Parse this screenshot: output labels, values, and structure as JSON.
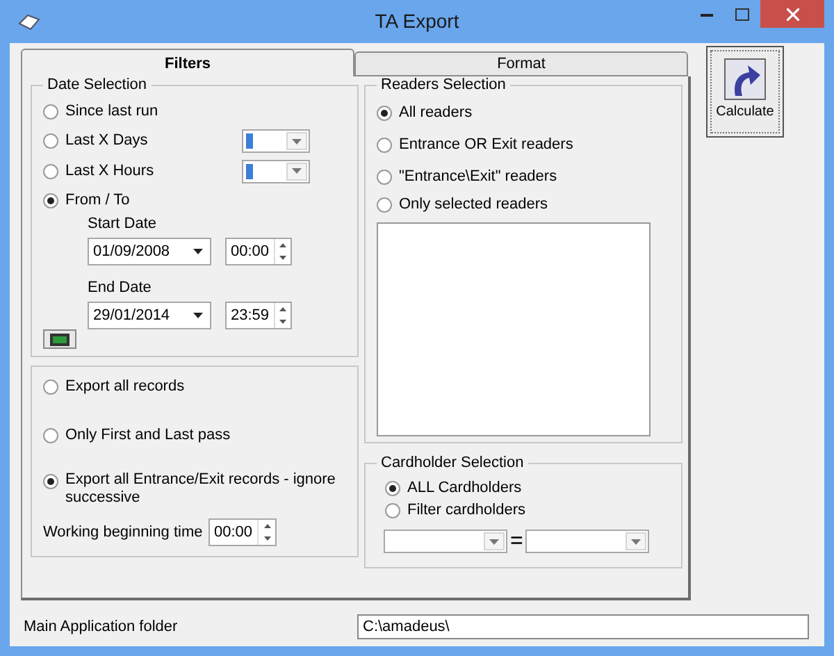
{
  "window": {
    "title": "TA Export"
  },
  "tabs": [
    {
      "label": "Filters",
      "selected": true
    },
    {
      "label": "Format",
      "selected": false
    }
  ],
  "date_selection": {
    "title": "Date Selection",
    "options": [
      {
        "label": "Since last run",
        "selected": false,
        "kind": "plain"
      },
      {
        "label": "Last X Days",
        "selected": false,
        "kind": "combo"
      },
      {
        "label": "Last X Hours",
        "selected": false,
        "kind": "combo"
      },
      {
        "label": "From / To",
        "selected": true,
        "kind": "plain"
      }
    ],
    "start": {
      "label": "Start Date",
      "date": "01/09/2008",
      "time": "00:00"
    },
    "end": {
      "label": "End Date",
      "date": "29/01/2014",
      "time": "23:59"
    }
  },
  "records": {
    "options": [
      {
        "label": "Export all records",
        "selected": false
      },
      {
        "label": "Only First and Last pass",
        "selected": false
      },
      {
        "label": "Export all Entrance/Exit records - ignore successive",
        "selected": true
      }
    ],
    "working_time": {
      "label": "Working beginning time",
      "value": "00:00"
    }
  },
  "readers": {
    "title": "Readers Selection",
    "options": [
      {
        "label": "All readers",
        "selected": true
      },
      {
        "label": "Entrance OR Exit readers",
        "selected": false
      },
      {
        "label": "\"Entrance\\Exit\" readers",
        "selected": false
      },
      {
        "label": "Only selected readers",
        "selected": false
      }
    ]
  },
  "cardholders": {
    "title": "Cardholder Selection",
    "options": [
      {
        "label": "ALL Cardholders",
        "selected": true
      },
      {
        "label": "Filter cardholders",
        "selected": false
      }
    ],
    "operator": "="
  },
  "calculate": {
    "label": "Calculate"
  },
  "folder": {
    "label": "Main Application folder",
    "value": "C:\\amadeus\\"
  }
}
